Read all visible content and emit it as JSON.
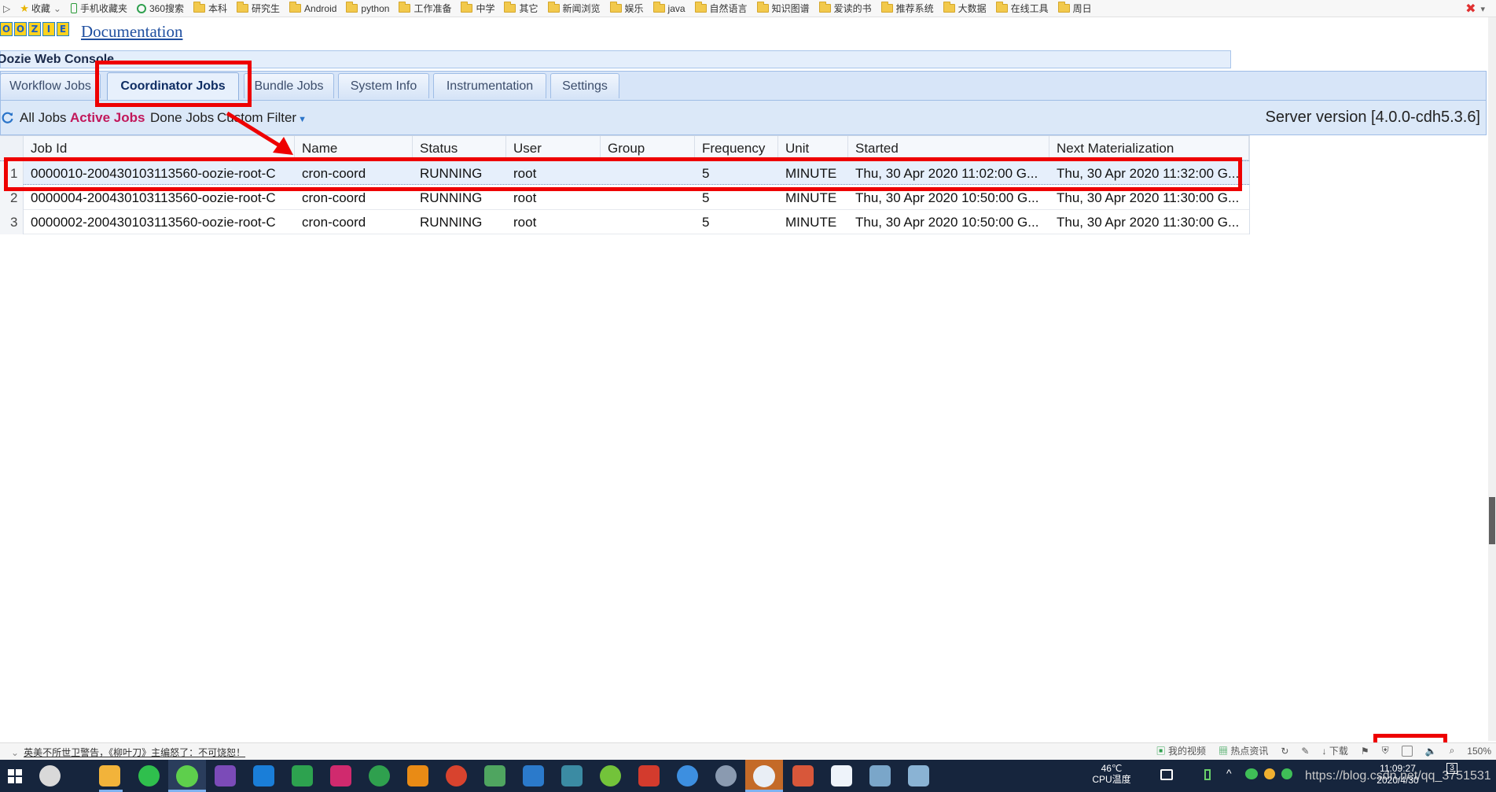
{
  "bookmarks": {
    "items": [
      "收藏",
      "手机收藏夹",
      "360搜索",
      "本科",
      "研究生",
      "Android",
      "python",
      "工作准备",
      "中学",
      "其它",
      "新闻浏览",
      "娱乐",
      "java",
      "自然语言",
      "知识图谱",
      "爱读的书",
      "推荐系统",
      "大数据",
      "在线工具",
      "周日"
    ]
  },
  "header": {
    "logo_letters": [
      "O",
      "O",
      "Z",
      "I",
      "E"
    ],
    "doc_link": "Documentation",
    "console_title": "Oozie Web Console"
  },
  "tabs": [
    {
      "label": "Workflow Jobs",
      "active": false
    },
    {
      "label": "Coordinator Jobs",
      "active": true
    },
    {
      "label": "Bundle Jobs",
      "active": false
    },
    {
      "label": "System Info",
      "active": false
    },
    {
      "label": "Instrumentation",
      "active": false
    },
    {
      "label": "Settings",
      "active": false
    }
  ],
  "toolbar": {
    "filters": [
      {
        "label": "All Jobs",
        "active": false
      },
      {
        "label": "Active Jobs",
        "active": true
      },
      {
        "label": "Done Jobs",
        "active": false
      }
    ],
    "custom_filter": "Custom Filter",
    "server_version": "Server version [4.0.0-cdh5.3.6]"
  },
  "table": {
    "columns": [
      "Job Id",
      "Name",
      "Status",
      "User",
      "Group",
      "Frequency",
      "Unit",
      "Started",
      "Next Materialization"
    ],
    "rows": [
      {
        "num": "1",
        "job_id": "0000010-200430103113560-oozie-root-C",
        "name": "cron-coord",
        "status": "RUNNING",
        "user": "root",
        "group": "",
        "frequency": "5",
        "unit": "MINUTE",
        "started": "Thu, 30 Apr 2020 11:02:00 G...",
        "next": "Thu, 30 Apr 2020 11:32:00 G...",
        "selected": true
      },
      {
        "num": "2",
        "job_id": "0000004-200430103113560-oozie-root-C",
        "name": "cron-coord",
        "status": "RUNNING",
        "user": "root",
        "group": "",
        "frequency": "5",
        "unit": "MINUTE",
        "started": "Thu, 30 Apr 2020 10:50:00 G...",
        "next": "Thu, 30 Apr 2020 11:30:00 G...",
        "selected": false
      },
      {
        "num": "3",
        "job_id": "0000002-200430103113560-oozie-root-C",
        "name": "cron-coord",
        "status": "RUNNING",
        "user": "root",
        "group": "",
        "frequency": "5",
        "unit": "MINUTE",
        "started": "Thu, 30 Apr 2020 10:50:00 G...",
        "next": "Thu, 30 Apr 2020 11:30:00 G...",
        "selected": false
      }
    ]
  },
  "statusbar": {
    "news": "英美不所世卫警告，《柳叶刀》主编怒了：不可饶恕！",
    "my_video": "我的视频",
    "hot_news": "热点资讯",
    "download": "下载",
    "zoom": "150%"
  },
  "taskbar": {
    "temperature": "46℃",
    "cpu_label": "CPU温度",
    "time": "11:09:27",
    "date": "2020/4/30",
    "watermark": "https://blog.csdn.net/qq_3751531",
    "notification_count": "3"
  },
  "colors": {
    "annotation_red": "#ee0000",
    "active_filter": "#c2185b",
    "link_blue": "#1f4fa0",
    "taskbar_bg": "#16253d"
  }
}
